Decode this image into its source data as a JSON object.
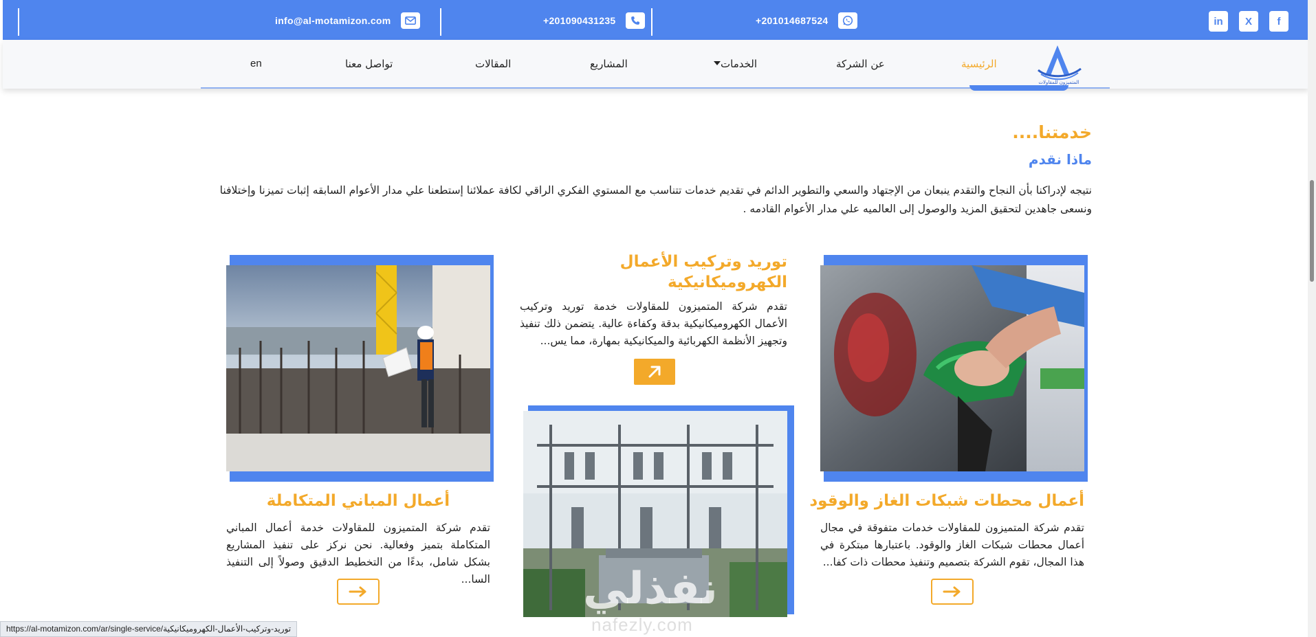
{
  "topbar": {
    "email": "info@al-motamizon.com",
    "phone1": "+201090431235",
    "phone2": "+201014687524",
    "social": [
      {
        "name": "linkedin",
        "label": "in"
      },
      {
        "name": "x",
        "label": "X"
      },
      {
        "name": "facebook",
        "label": "f"
      }
    ]
  },
  "nav": {
    "home": "الرئيسية",
    "about": "عن الشركة",
    "services": "الخدمات",
    "projects": "المشاريع",
    "articles": "المقالات",
    "contact": "تواصل معنا",
    "lang": "en",
    "logo_text": "المتميزون للمقاولات"
  },
  "section": {
    "title": "خدمتنا....",
    "subtitle": "ماذا نقدم",
    "description": "نتيجه لإدراكنا بأن النجاح والتقدم ينبعان من الإجتهاد والسعي والتطوير الدائم في تقديم خدمات تتناسب مع المستوي الفكري الراقي لكافة عملائنا إستطعنا علي مدار الأعوام السابقه إثبات تميزنا وإختلافنا ونسعى جاهدين لتحقيق المزيد والوصول إلى العالميه علي مدار الأعوام القادمه ."
  },
  "cards": [
    {
      "title": "أعمال محطات شبكات الغاز والوقود",
      "text": "تقدم شركة المتميزون للمقاولات خدمات متفوقة في مجال أعمال محطات شبكات الغاز والوقود. باعتبارها مبتكرة في هذا المجال، تقوم الشركة بتصميم وتنفيذ محطات ذات كفا..."
    },
    {
      "title": "توريد وتركيب الأعمال الكهروميكانيكية",
      "text": "تقدم شركة المتميزون للمقاولات خدمة توريد وتركيب الأعمال الكهروميكانيكية بدقة وكفاءة عالية. يتضمن ذلك تنفيذ وتجهيز الأنظمة الكهربائية والميكانيكية بمهارة، مما يس..."
    },
    {
      "title": "أعمال المباني المتكاملة",
      "text": "تقدم شركة المتميزون للمقاولات خدمة أعمال المباني المتكاملة بتميز وفعالية. نحن نركز على تنفيذ المشاريع بشكل شامل، بدءًا من التخطيط الدقيق وصولاً إلى التنفيذ السا..."
    }
  ],
  "watermark": {
    "arabic": "نفذلي",
    "latin": "nafezly.com"
  },
  "status_url": "https://al-motamizon.com/ar/single-service/توريد-وتركيب-الأعمال-الكهروميكانيكية",
  "colors": {
    "primary_blue": "#4f85ee",
    "accent_orange": "#f3a92a"
  }
}
